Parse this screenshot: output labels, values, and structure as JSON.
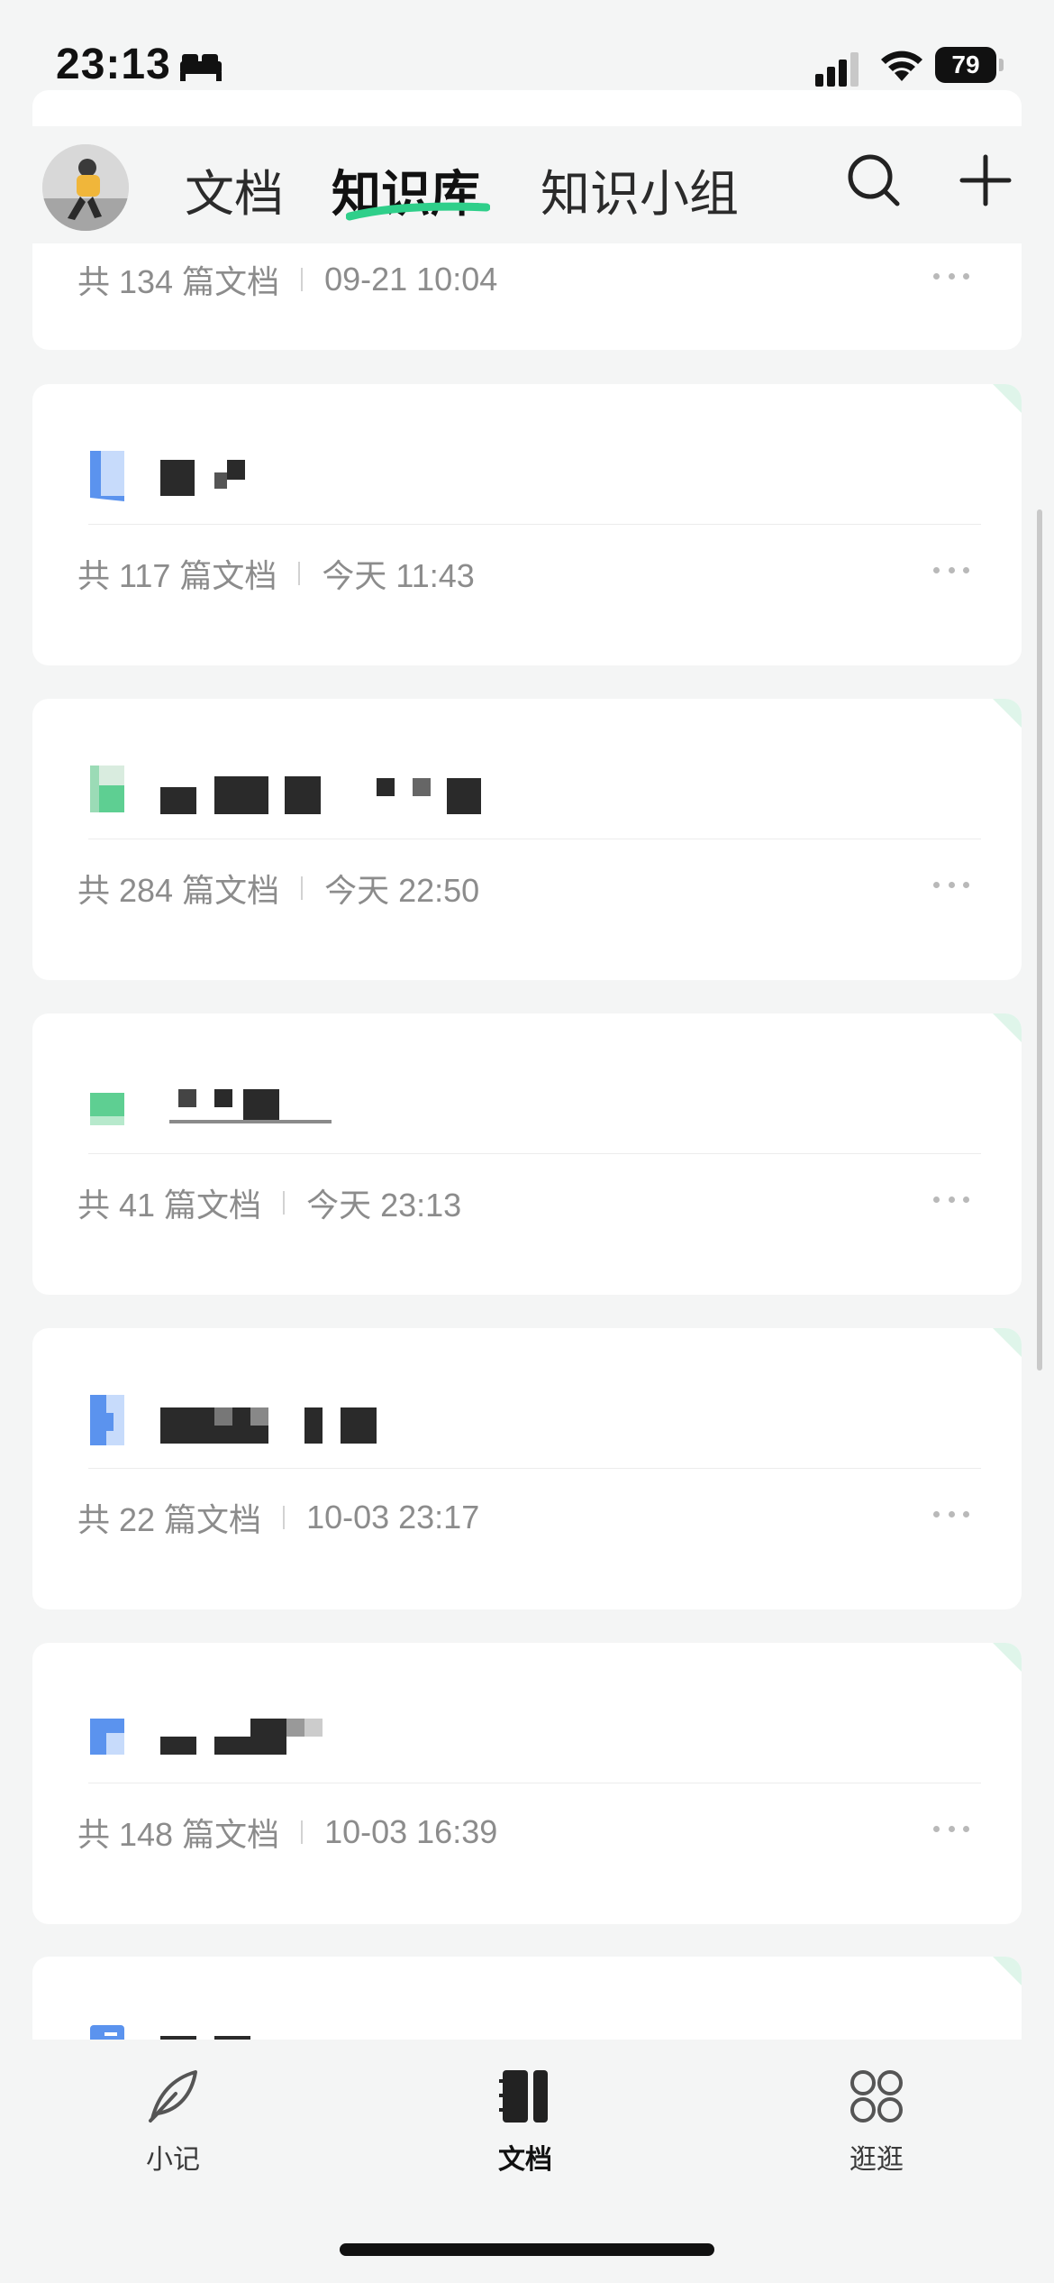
{
  "status_bar": {
    "time": "23:13",
    "battery": "79"
  },
  "top_nav": {
    "tabs": [
      {
        "label": "文档",
        "active": false
      },
      {
        "label": "知识库",
        "active": true
      },
      {
        "label": "知识小组",
        "active": false
      }
    ],
    "accent_color": "#2fcf8a"
  },
  "cards": [
    {
      "doc_count": "共 134 篇文档",
      "updated": "09-21 10:04",
      "icon_color": "#5b93ee"
    },
    {
      "doc_count": "共 117 篇文档",
      "updated": "今天 11:43",
      "icon_color": "#5b93ee"
    },
    {
      "doc_count": "共 284 篇文档",
      "updated": "今天 22:50",
      "icon_color": "#5ecf92"
    },
    {
      "doc_count": "共 41 篇文档",
      "updated": "今天 23:13",
      "icon_color": "#5ecf92"
    },
    {
      "doc_count": "共 22 篇文档",
      "updated": "10-03 23:17",
      "icon_color": "#5b93ee"
    },
    {
      "doc_count": "共 148 篇文档",
      "updated": "10-03 16:39",
      "icon_color": "#5b93ee"
    },
    {
      "doc_count": "",
      "updated": "",
      "icon_color": "#5b93ee"
    }
  ],
  "tab_bar": {
    "items": [
      {
        "label": "小记",
        "icon": "feather-icon",
        "active": false
      },
      {
        "label": "文档",
        "icon": "notebook-icon",
        "active": true
      },
      {
        "label": "逛逛",
        "icon": "discover-icon",
        "active": false
      }
    ]
  }
}
